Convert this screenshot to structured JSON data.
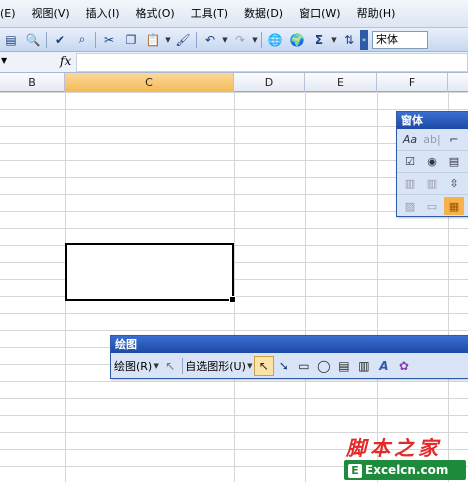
{
  "menu": [
    "(E)",
    "视图(V)",
    "插入(I)",
    "格式(O)",
    "工具(T)",
    "数据(D)",
    "窗口(W)",
    "帮助(H)"
  ],
  "toolbar": {
    "font_name": "宋体"
  },
  "formula": {
    "fx": "fx",
    "value": ""
  },
  "columns": [
    {
      "label": "B",
      "selected": false
    },
    {
      "label": "C",
      "selected": true
    },
    {
      "label": "D",
      "selected": false
    },
    {
      "label": "E",
      "selected": false
    },
    {
      "label": "F",
      "selected": false
    }
  ],
  "forms_palette": {
    "title": "窗体"
  },
  "drawing_toolbar": {
    "title": "绘图",
    "draw_menu": "绘图(R)",
    "autoshapes_menu": "自选图形(U)"
  },
  "watermark": {
    "top": "脚本之家",
    "logo": "E",
    "bottom": "Excelcn.com"
  },
  "colors": {
    "selected_column": "#f4b957",
    "title_bar": "#1d49a6",
    "watermark_red": "#e32a2a",
    "watermark_green": "#1e8a3c"
  }
}
